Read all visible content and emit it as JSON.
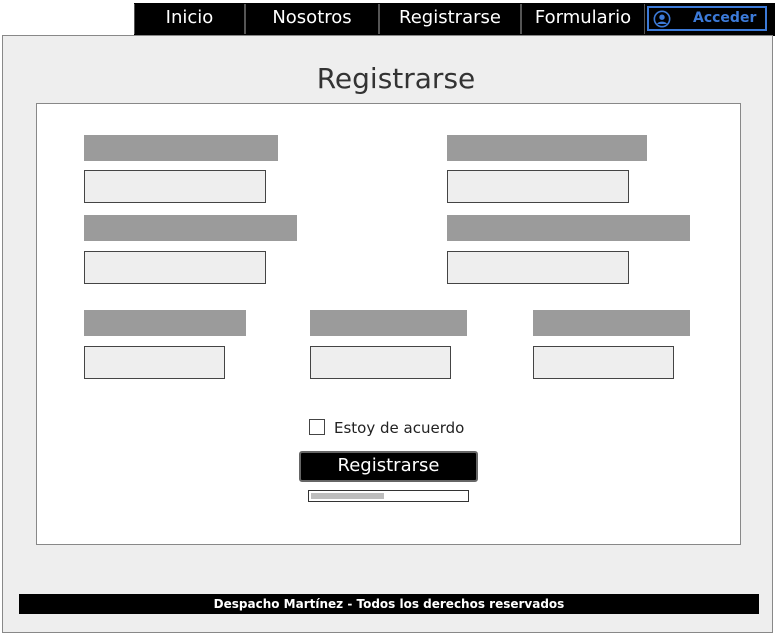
{
  "nav": {
    "items": [
      {
        "label": "Inicio"
      },
      {
        "label": "Nosotros"
      },
      {
        "label": "Registrarse"
      },
      {
        "label": "Formulario"
      }
    ],
    "login_label": "Acceder",
    "login_icon": "user-circle-icon",
    "accent_color": "#3c7ad8"
  },
  "main": {
    "title": "Registrarse"
  },
  "form": {
    "fields": [
      {
        "label": "",
        "value": "",
        "placeholder": ""
      },
      {
        "label": "",
        "value": "",
        "placeholder": ""
      },
      {
        "label": "",
        "value": "",
        "placeholder": ""
      },
      {
        "label": "",
        "value": "",
        "placeholder": ""
      },
      {
        "label": "",
        "value": "",
        "placeholder": ""
      },
      {
        "label": "",
        "value": "",
        "placeholder": ""
      },
      {
        "label": "",
        "value": "",
        "placeholder": ""
      }
    ],
    "agree_label": "Estoy de acuerdo",
    "agree_checked": false,
    "submit_label": "Registrarse",
    "progress": 0.47
  },
  "footer": {
    "text": "Despacho Martínez - Todos los derechos reservados"
  }
}
